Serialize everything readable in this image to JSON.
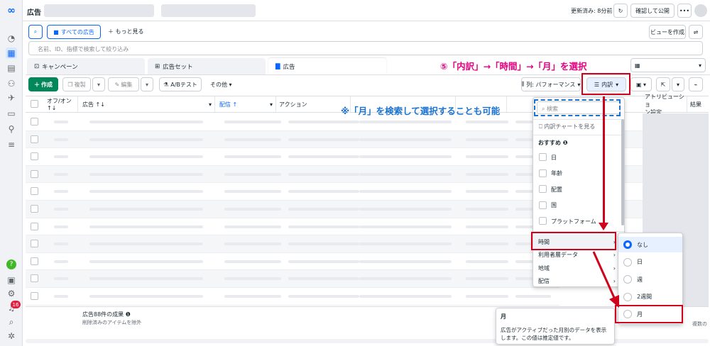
{
  "topbar": {
    "title": "広告",
    "updated": "更新済み: 8分前",
    "confirm_publish": "確認して公開",
    "more": "•••"
  },
  "search": {
    "all_ads": "すべての広告",
    "more": "もっと見る",
    "placeholder": "名前、ID、指標で検索して絞り込み",
    "create_view": "ビューを作成"
  },
  "tabs": [
    {
      "label": "キャンペーン"
    },
    {
      "label": "広告セット"
    },
    {
      "label": "広告"
    }
  ],
  "toolbar": {
    "create": "作成",
    "duplicate": "複製",
    "edit": "編集",
    "ab_test": "A/Bテスト",
    "other": "その他",
    "columns": "列: パフォーマンス",
    "breakdown": "内訳"
  },
  "table": {
    "headers": {
      "onoff": "オフ/オン",
      "sort": "↑↓",
      "ad": "広告 ↑↓",
      "delivery": "配信 ↑",
      "action": "アクション",
      "attr1": "アトリビューショ",
      "attr2": "ン設定",
      "result": "結果"
    },
    "footer_title": "広告88件の成果",
    "footer_sub": "削除済みのアイテムを除外",
    "footer_right": "複数の"
  },
  "breakdown_menu": {
    "search_placeholder": "検索",
    "chart_link": "内訳チャートを見る",
    "recommended": "おすすめ",
    "items": [
      "日",
      "年齢",
      "配置",
      "国",
      "プラットフォーム"
    ],
    "groups": [
      "時間",
      "利用者層データ",
      "地域",
      "配信"
    ]
  },
  "time_submenu": {
    "options": [
      "なし",
      "日",
      "週",
      "2週間",
      "月"
    ]
  },
  "tooltip": {
    "title": "月",
    "body": "広告がアクティブだった月別のデータを表示します。この値は推定値です。"
  },
  "annotations": {
    "step": "⑤「内訳」→「時間」→「月」を選択",
    "note": "※「月」を検索して選択することも可能"
  },
  "sidebar": {
    "badge": "16"
  },
  "colors": {
    "accent": "#0866ff",
    "create_green": "#00875a",
    "annotation_pink": "#e4007f",
    "highlight_red": "#d0021b"
  }
}
